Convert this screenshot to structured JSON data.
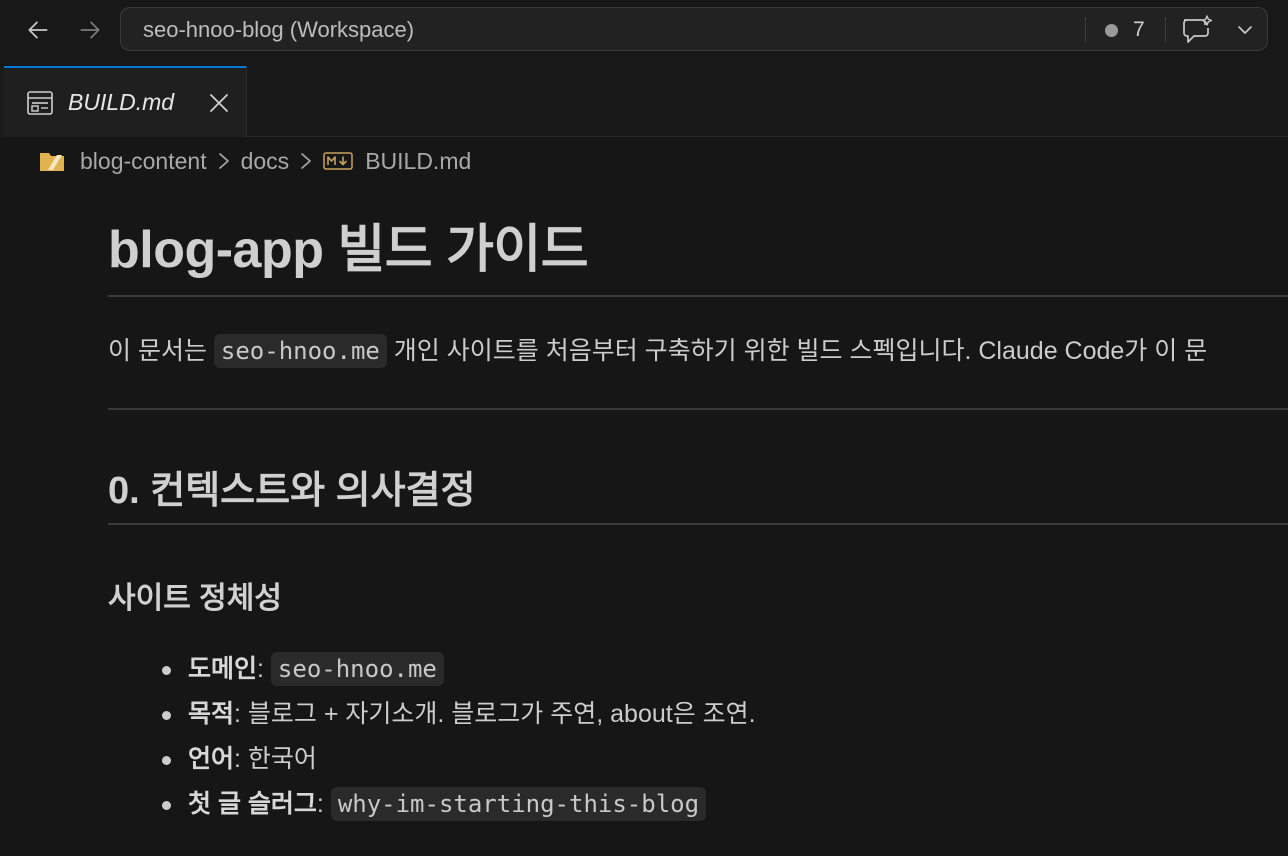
{
  "titlebar": {
    "workspace_title": "seo-hnoo-blog (Workspace)",
    "notification_count": "7"
  },
  "tab": {
    "label": "BUILD.md"
  },
  "breadcrumb": {
    "items": [
      "blog-content",
      "docs",
      "BUILD.md"
    ]
  },
  "document": {
    "h1": "blog-app 빌드 가이드",
    "intro": {
      "before": "이 문서는 ",
      "code": "seo-hnoo.me",
      "after": " 개인 사이트를 처음부터 구축하기 위한 빌드 스펙입니다. Claude Code가 이 문"
    },
    "h2": "0. 컨텍스트와 의사결정",
    "h3": "사이트 정체성",
    "list": [
      {
        "key": "도메인",
        "sep": ": ",
        "code": "seo-hnoo.me",
        "text": ""
      },
      {
        "key": "목적",
        "sep": ": ",
        "code": "",
        "text": "블로그 + 자기소개. 블로그가 주연, about은 조연."
      },
      {
        "key": "언어",
        "sep": ": ",
        "code": "",
        "text": "한국어"
      },
      {
        "key": "첫 글 슬러그",
        "sep": ": ",
        "code": "why-im-starting-this-blog",
        "text": ""
      }
    ]
  },
  "colors": {
    "accent": "#0078d4",
    "background": "#161617",
    "folder_icon": "#e0b24d",
    "md_icon": "#c9a25c"
  }
}
